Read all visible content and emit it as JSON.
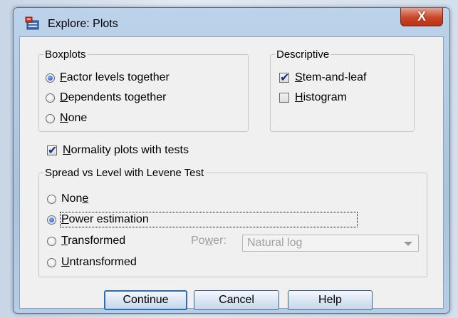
{
  "window": {
    "title": "Explore: Plots",
    "close_label": "X"
  },
  "boxplots": {
    "legend": "Boxplots",
    "options": [
      {
        "label": "Factor levels together",
        "accel": "F",
        "rest": "actor levels together",
        "checked": true
      },
      {
        "label": "Dependents together",
        "accel": "D",
        "rest": "ependents together",
        "checked": false
      },
      {
        "label": "None",
        "accel": "N",
        "rest": "one",
        "checked": false
      }
    ]
  },
  "descriptive": {
    "legend": "Descriptive",
    "options": [
      {
        "label": "Stem-and-leaf",
        "accel": "S",
        "rest": "tem-and-leaf",
        "checked": true
      },
      {
        "label": "Histogram",
        "accel": "H",
        "rest": "istogram",
        "checked": false
      }
    ]
  },
  "normality": {
    "label": "Normality plots with tests",
    "accel": "N",
    "rest": "ormality plots with tests",
    "checked": true
  },
  "spread": {
    "legend": "Spread vs Level with Levene Test",
    "none": {
      "pre": "Non",
      "accel": "e",
      "checked": false
    },
    "power_estimation": {
      "accel": "P",
      "rest": "ower estimation",
      "checked": true
    },
    "transformed": {
      "accel": "T",
      "rest": "ransformed",
      "checked": false
    },
    "power_label": {
      "pre": "Po",
      "accel": "w",
      "rest": "er:"
    },
    "power_select": {
      "value": "Natural log"
    },
    "untransformed": {
      "accel": "U",
      "rest": "ntransformed",
      "checked": false
    }
  },
  "buttons": {
    "continue": "Continue",
    "cancel": "Cancel",
    "help": "Help"
  },
  "colors": {
    "title_bar": "#aac3de",
    "close_button": "#c9462a",
    "dialog_background": "#f0f0f0",
    "check_mark": "#1d2f8a",
    "radio_dot": "#1a4fc2"
  }
}
